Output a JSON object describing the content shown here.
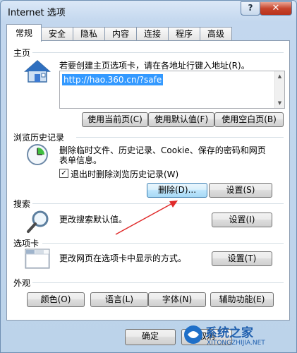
{
  "window": {
    "title": "Internet 选项",
    "help_label": "?",
    "close_label": "✕"
  },
  "tabs": [
    {
      "label": "常规",
      "active": true
    },
    {
      "label": "安全"
    },
    {
      "label": "隐私"
    },
    {
      "label": "内容"
    },
    {
      "label": "连接"
    },
    {
      "label": "程序"
    },
    {
      "label": "高级"
    }
  ],
  "home": {
    "section_label": "主页",
    "description": "若要创建主页选项卡，请在各地址行键入地址(R)。",
    "url": "http://hao.360.cn/?safe",
    "use_current_label": "使用当前页(C)",
    "use_default_label": "使用默认值(F)",
    "use_blank_label": "使用空白页(B)"
  },
  "history": {
    "section_label": "浏览历史记录",
    "description_line1": "删除临时文件、历史记录、Cookie、保存的密码和网页",
    "description_line2": "表单信息。",
    "delete_on_exit_label": "退出时删除浏览历史记录(W)",
    "delete_on_exit_checked": true,
    "delete_label": "删除(D)...",
    "settings_label": "设置(S)"
  },
  "search": {
    "section_label": "搜索",
    "description": "更改搜索默认值。",
    "settings_label": "设置(I)"
  },
  "tabs_section": {
    "section_label": "选项卡",
    "description": "更改网页在选项卡中显示的方式。",
    "settings_label": "设置(T)"
  },
  "appearance": {
    "section_label": "外观",
    "colors_label": "颜色(O)",
    "languages_label": "语言(L)",
    "fonts_label": "字体(N)",
    "accessibility_label": "辅助功能(E)"
  },
  "footer": {
    "ok_label": "确定",
    "cancel_label": "取消"
  },
  "watermark": {
    "brand_text": "系统之家",
    "url_text": "XITONGZHIJIA.NET"
  },
  "colors": {
    "accent": "#3399ff",
    "annotation_arrow": "#e02a2a",
    "close_red": "#c7452d"
  },
  "icons": [
    "home-icon",
    "history-clock-icon",
    "search-magnifier-icon",
    "tabs-window-icon"
  ]
}
